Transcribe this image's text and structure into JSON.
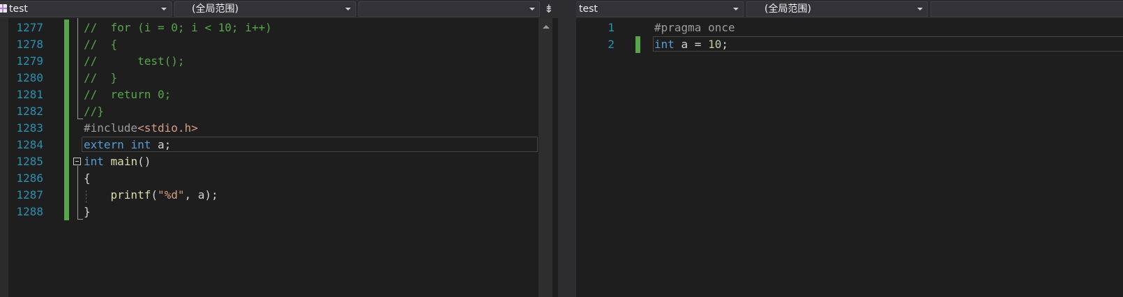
{
  "left_pane": {
    "nav": {
      "file": "test",
      "scope": "(全局范围)",
      "member": ""
    },
    "lines": [
      {
        "num": "1277",
        "tokens": [
          {
            "t": "//  for (i = 0; i < 10; i++)",
            "c": "com"
          }
        ]
      },
      {
        "num": "1278",
        "tokens": [
          {
            "t": "//  {",
            "c": "com"
          }
        ]
      },
      {
        "num": "1279",
        "tokens": [
          {
            "t": "//      test();",
            "c": "com"
          }
        ]
      },
      {
        "num": "1280",
        "tokens": [
          {
            "t": "//  }",
            "c": "com"
          }
        ]
      },
      {
        "num": "1281",
        "tokens": [
          {
            "t": "//  return 0;",
            "c": "com"
          }
        ]
      },
      {
        "num": "1282",
        "tokens": [
          {
            "t": "//}",
            "c": "com"
          }
        ]
      },
      {
        "num": "1283",
        "tokens": [
          {
            "t": "#include",
            "c": "pp"
          },
          {
            "t": "<stdio.h>",
            "c": "inc"
          }
        ]
      },
      {
        "num": "1284",
        "tokens": [
          {
            "t": "extern",
            "c": "kw"
          },
          {
            "t": " ",
            "c": ""
          },
          {
            "t": "int",
            "c": "kw"
          },
          {
            "t": " a;",
            "c": ""
          }
        ]
      },
      {
        "num": "1285",
        "tokens": [
          {
            "t": "int",
            "c": "kw"
          },
          {
            "t": " ",
            "c": ""
          },
          {
            "t": "main",
            "c": "fn"
          },
          {
            "t": "()",
            "c": ""
          }
        ]
      },
      {
        "num": "1286",
        "tokens": [
          {
            "t": "{",
            "c": ""
          }
        ]
      },
      {
        "num": "1287",
        "tokens": [
          {
            "t": "    ",
            "c": ""
          },
          {
            "t": "printf",
            "c": "fn"
          },
          {
            "t": "(",
            "c": ""
          },
          {
            "t": "\"%d\"",
            "c": "str"
          },
          {
            "t": ", a);",
            "c": ""
          }
        ]
      },
      {
        "num": "1288",
        "tokens": [
          {
            "t": "}",
            "c": ""
          }
        ]
      }
    ]
  },
  "right_pane": {
    "nav": {
      "file": "test",
      "scope": "(全局范围)",
      "member": ""
    },
    "lines": [
      {
        "num": "1",
        "tokens": [
          {
            "t": "#pragma once",
            "c": "pp"
          }
        ]
      },
      {
        "num": "2",
        "tokens": [
          {
            "t": "int",
            "c": "kw"
          },
          {
            "t": " a = ",
            "c": ""
          },
          {
            "t": "10",
            "c": "num"
          },
          {
            "t": ";",
            "c": ""
          }
        ]
      }
    ]
  },
  "icons": {
    "file_icon": "cpp-file-icon",
    "split": "split-window-icon",
    "split_glyph": "⇟"
  }
}
